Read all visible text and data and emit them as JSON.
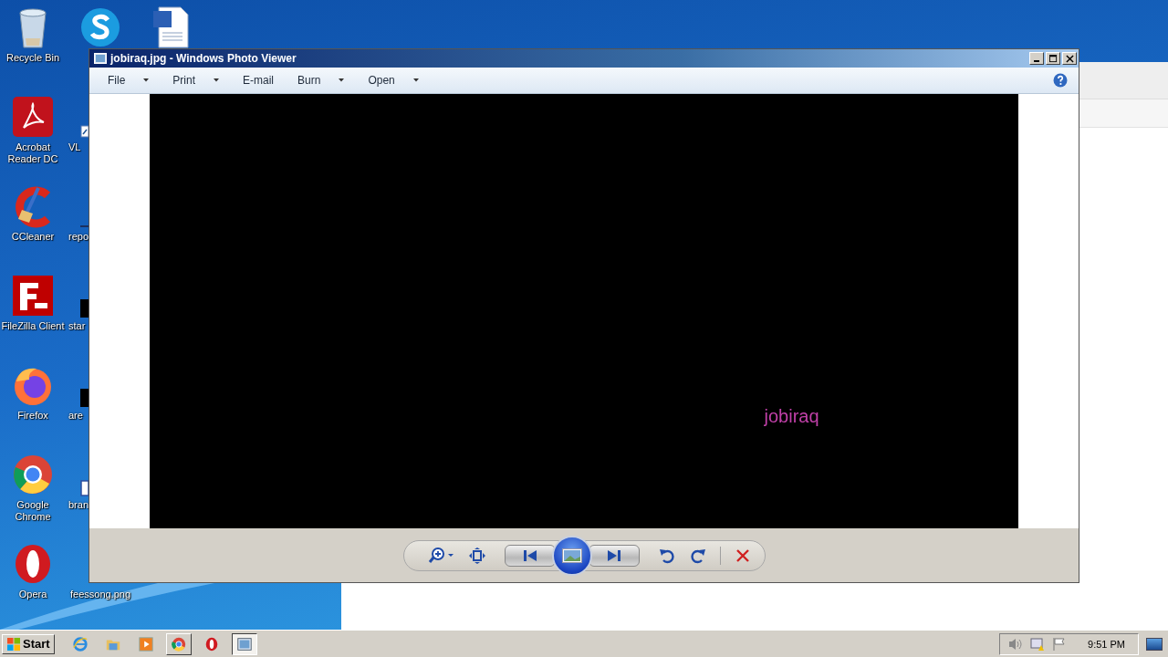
{
  "desktop": {
    "icons": [
      {
        "kind": "recycle",
        "label": "Recycle Bin"
      },
      {
        "kind": "acrobat",
        "label": "Acrobat Reader DC"
      },
      {
        "kind": "ccleaner",
        "label": "CCleaner"
      },
      {
        "kind": "filezilla",
        "label": "FileZilla Client"
      },
      {
        "kind": "firefox",
        "label": "Firefox"
      },
      {
        "kind": "chrome",
        "label": "Google Chrome"
      },
      {
        "kind": "opera",
        "label": "Opera"
      },
      {
        "kind": "skype"
      },
      {
        "kind": "shortcut",
        "label": "VL"
      },
      {
        "kind": "dash",
        "label": "repo"
      },
      {
        "kind": "black",
        "label": "star"
      },
      {
        "kind": "black",
        "label": "are"
      },
      {
        "kind": "doc",
        "label": "bran"
      },
      {
        "kind": "none",
        "label": "feessong.png"
      },
      {
        "kind": "word"
      }
    ]
  },
  "window": {
    "title": "jobiraq.jpg - Windows Photo Viewer",
    "menu": [
      {
        "label": "File",
        "dropdown": true
      },
      {
        "label": "Print",
        "dropdown": true
      },
      {
        "label": "E-mail",
        "dropdown": false
      },
      {
        "label": "Burn",
        "dropdown": true
      },
      {
        "label": "Open",
        "dropdown": true
      }
    ],
    "image": {
      "caption": "jobiraq"
    }
  },
  "taskbar": {
    "start": "Start",
    "items": [
      {
        "kind": "browser",
        "selected": false
      },
      {
        "kind": "folder",
        "selected": false
      },
      {
        "kind": "media",
        "selected": false
      },
      {
        "kind": "chrome",
        "selected": false
      },
      {
        "kind": "opera",
        "selected": false
      },
      {
        "kind": "viewer",
        "selected": true
      }
    ],
    "clock": "9:51 PM"
  }
}
